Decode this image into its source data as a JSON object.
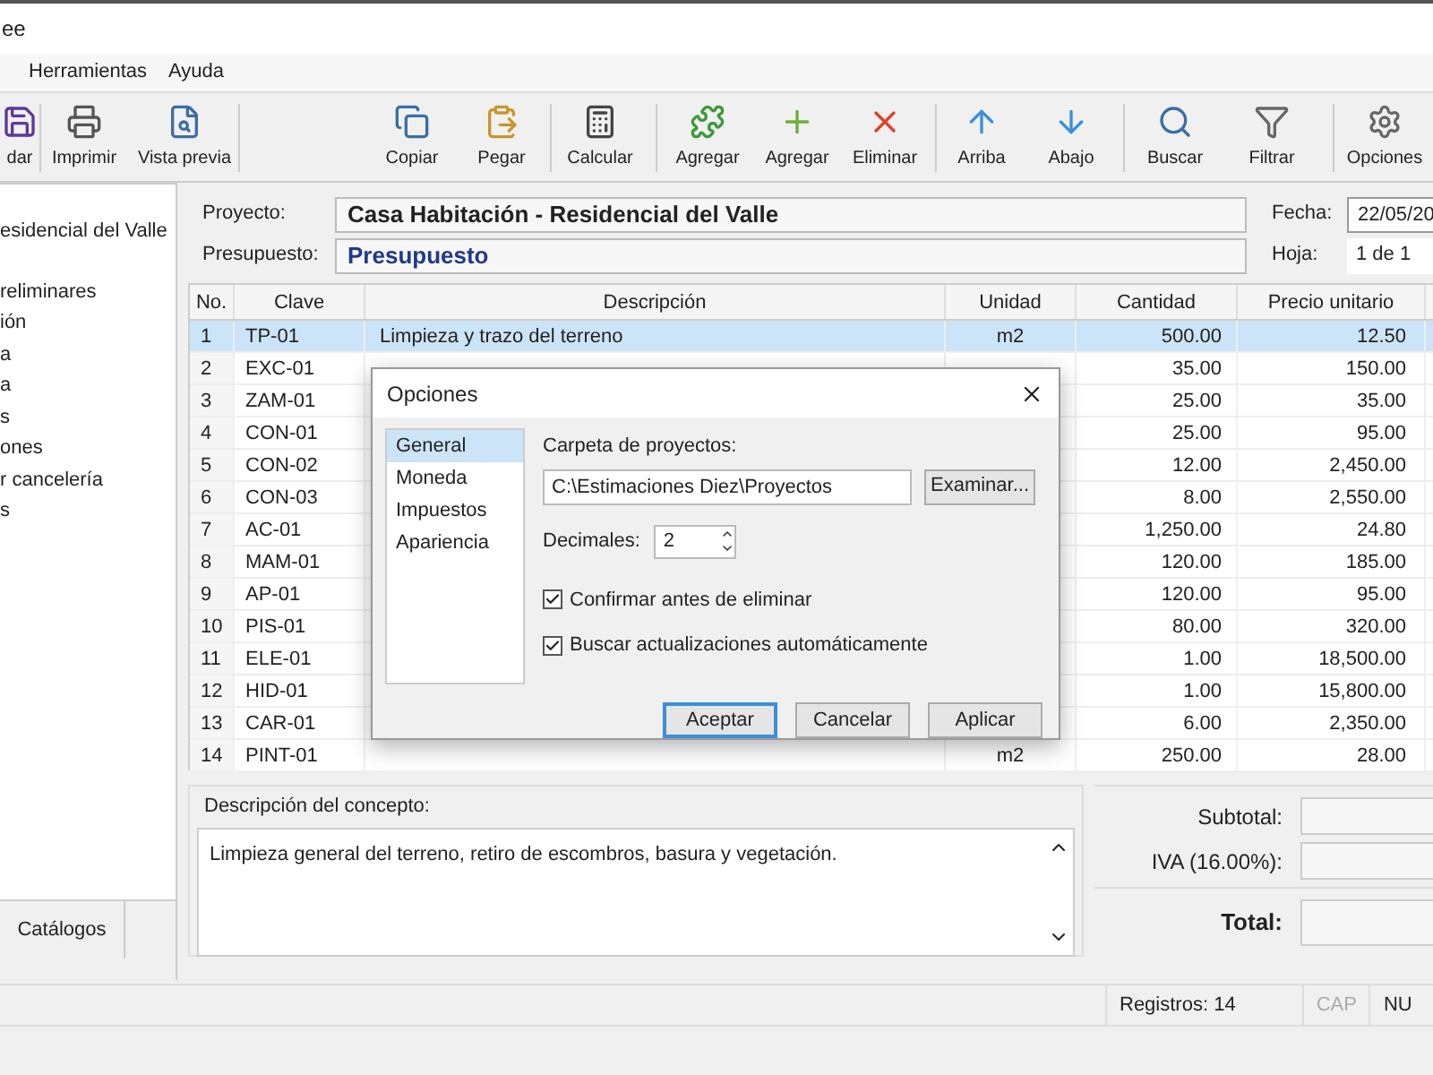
{
  "window": {
    "title": "ee"
  },
  "menu": [
    "Herramientas",
    "Ayuda"
  ],
  "toolbar": [
    {
      "label": "dar"
    },
    {
      "label": "Imprimir"
    },
    {
      "label": "Vista previa"
    },
    {
      "label": "Copiar"
    },
    {
      "label": "Pegar"
    },
    {
      "label": "Calcular"
    },
    {
      "label": "Agregar"
    },
    {
      "label": "Agregar"
    },
    {
      "label": "Eliminar"
    },
    {
      "label": "Arriba"
    },
    {
      "label": "Abajo"
    },
    {
      "label": "Buscar"
    },
    {
      "label": "Filtrar"
    },
    {
      "label": "Opciones"
    }
  ],
  "tree": {
    "label": "esidencial del Valle",
    "children": [
      {
        "label": "reliminares"
      },
      {
        "label": "ión"
      },
      {
        "label": "a"
      },
      {
        "label": "a"
      },
      {
        "label": "s"
      },
      {
        "label": "ones"
      },
      {
        "label": "r cancelería"
      },
      {
        "label": "s"
      }
    ]
  },
  "side_tabs": [
    {
      "label": "Catálogos",
      "selected": false
    }
  ],
  "header": {
    "project_label": "Proyecto:",
    "project": "Casa Habitación - Residencial del Valle",
    "budget_label": "Presupuesto:",
    "budget": "Presupuesto",
    "date_label": "Fecha:",
    "date": "22/05/20",
    "sheet_label": "Hoja:",
    "sheet": "1 de 1"
  },
  "table": {
    "columns": [
      "No.",
      "Clave",
      "Descripción",
      "Unidad",
      "Cantidad",
      "Precio unitario"
    ],
    "rows": [
      {
        "no": "1",
        "clave": "TP-01",
        "descripcion": "Limpieza y trazo del terreno",
        "unidad": "m2",
        "cantidad": "500.00",
        "precio": "12.50",
        "selected": true
      },
      {
        "no": "2",
        "clave": "EXC-01",
        "cantidad": "35.00",
        "precio": "150.00",
        "selected": false
      },
      {
        "no": "3",
        "clave": "ZAM-01",
        "cantidad": "25.00",
        "precio": "35.00",
        "selected": false
      },
      {
        "no": "4",
        "clave": "CON-01",
        "cantidad": "25.00",
        "precio": "95.00",
        "selected": false
      },
      {
        "no": "5",
        "clave": "CON-02",
        "cantidad": "12.00",
        "precio": "2,450.00",
        "selected": false
      },
      {
        "no": "6",
        "clave": "CON-03",
        "cantidad": "8.00",
        "precio": "2,550.00",
        "selected": false
      },
      {
        "no": "7",
        "clave": "AC-01",
        "cantidad": "1,250.00",
        "precio": "24.80",
        "selected": false
      },
      {
        "no": "8",
        "clave": "MAM-01",
        "cantidad": "120.00",
        "precio": "185.00",
        "selected": false
      },
      {
        "no": "9",
        "clave": "AP-01",
        "cantidad": "120.00",
        "precio": "95.00",
        "selected": false
      },
      {
        "no": "10",
        "clave": "PIS-01",
        "cantidad": "80.00",
        "precio": "320.00",
        "selected": false
      },
      {
        "no": "11",
        "clave": "ELE-01",
        "cantidad": "1.00",
        "precio": "18,500.00",
        "selected": false
      },
      {
        "no": "12",
        "clave": "HID-01",
        "cantidad": "1.00",
        "precio": "15,800.00",
        "selected": false
      },
      {
        "no": "13",
        "clave": "CAR-01",
        "cantidad": "6.00",
        "precio": "2,350.00",
        "selected": false
      },
      {
        "no": "14",
        "clave": "PINT-01",
        "unidad": "m2",
        "cantidad": "250.00",
        "precio": "28.00",
        "selected": false
      }
    ]
  },
  "concept": {
    "label": "Descripción del concepto:",
    "text": "Limpieza general del terreno, retiro de escombros, basura y vegetación."
  },
  "totals": [
    {
      "label": "Subtotal:",
      "bold": false
    },
    {
      "label": "IVA (16.00%):",
      "bold": false
    },
    {
      "label": "Total:",
      "bold": true
    }
  ],
  "status_bar": [
    {
      "text": "Registros: 14",
      "disabled": false
    },
    {
      "text": "CAP",
      "disabled": true
    },
    {
      "text": "NU",
      "disabled": false
    }
  ],
  "dialog": {
    "title": "Opciones",
    "categories": [
      {
        "label": "General",
        "selected": true
      },
      {
        "label": "Moneda",
        "selected": false
      },
      {
        "label": "Impuestos",
        "selected": false
      },
      {
        "label": "Apariencia",
        "selected": false
      }
    ],
    "folder_label": "Carpeta de proyectos:",
    "folder": "C:\\Estimaciones Diez\\Proyectos",
    "browse": "Examinar...",
    "decimals_label": "Decimales:",
    "decimals": "2",
    "options": [
      {
        "label": "Confirmar antes de eliminar",
        "checked": true
      },
      {
        "label": "Buscar actualizaciones automáticamente",
        "checked": true
      }
    ],
    "buttons": [
      {
        "label": "Aceptar",
        "default": true
      },
      {
        "label": "Cancelar",
        "default": false
      },
      {
        "label": "Aplicar",
        "default": false
      }
    ]
  }
}
